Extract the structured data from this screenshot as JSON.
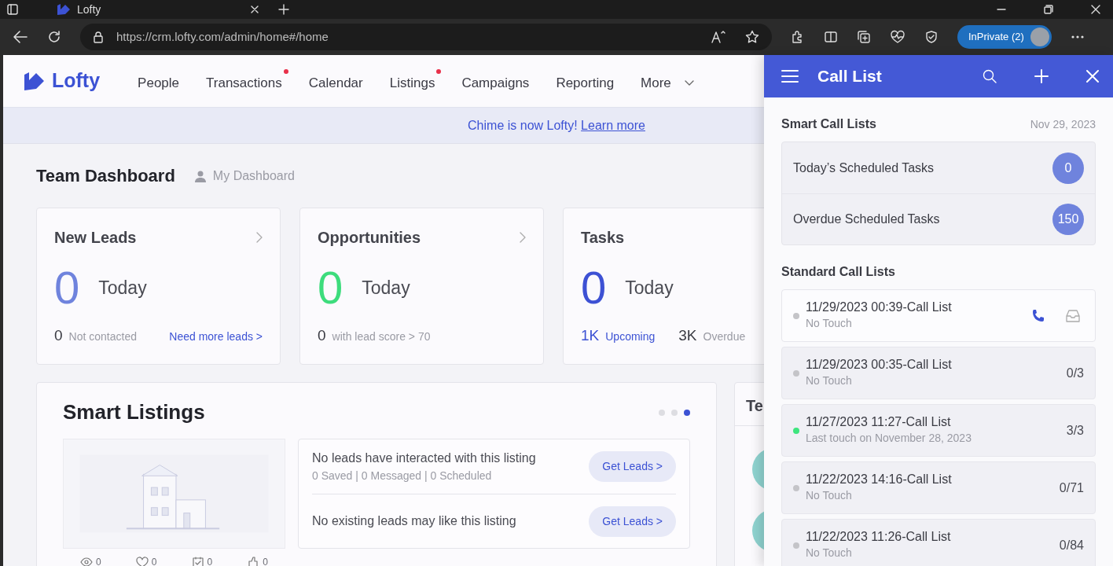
{
  "browser": {
    "tab_title": "Lofty",
    "url": "https://crm.lofty.com/admin/home#/home",
    "profile_label": "InPrivate (2)"
  },
  "nav": {
    "logo": "Lofty",
    "items": [
      {
        "label": "People",
        "dot": false,
        "kind": "link"
      },
      {
        "label": "Transactions",
        "dot": true,
        "kind": "link"
      },
      {
        "label": "Calendar",
        "dot": false,
        "kind": "link"
      },
      {
        "label": "Listings",
        "dot": true,
        "kind": "link"
      },
      {
        "label": "Campaigns",
        "dot": false,
        "kind": "link"
      },
      {
        "label": "Reporting",
        "dot": false,
        "kind": "link"
      },
      {
        "label": "More",
        "dot": false,
        "kind": "dropdown"
      }
    ]
  },
  "banner": {
    "text": "Chime is now Lofty!",
    "link": "Learn more"
  },
  "dashboard": {
    "title": "Team Dashboard",
    "switch_label": "My Dashboard"
  },
  "cards": [
    {
      "title": "New Leads",
      "arrow": true,
      "count": "0",
      "color": "#6f83dd",
      "period": "Today",
      "stats": [
        {
          "value": "0",
          "label": "Not contacted",
          "accent": false
        }
      ],
      "link": "Need more leads >"
    },
    {
      "title": "Opportunities",
      "arrow": true,
      "count": "0",
      "color": "#3ddc7c",
      "period": "Today",
      "stats": [
        {
          "value": "0",
          "label": "with lead score > 70",
          "accent": false
        }
      ]
    },
    {
      "title": "Tasks",
      "arrow": false,
      "count": "0",
      "color": "#3d51d4",
      "period": "Today",
      "stats": [
        {
          "value": "1K",
          "label": "Upcoming",
          "accent": true
        },
        {
          "value": "3K",
          "label": "Overdue",
          "accent": false
        }
      ]
    }
  ],
  "smart_listings": {
    "title": "Smart Listings",
    "pages": [
      {
        "selected": false
      },
      {
        "selected": false
      },
      {
        "selected": true
      }
    ],
    "listing": {
      "kind": "picture",
      "stats": [
        {
          "kind": "views",
          "value": "0"
        },
        {
          "kind": "likes",
          "value": "0"
        },
        {
          "kind": "scheduled",
          "value": "0"
        },
        {
          "kind": "shares",
          "value": "0"
        }
      ]
    },
    "rows": [
      {
        "text": "No leads have interacted with this listing",
        "detail": "0 Saved | 0 Messaged | 0 Scheduled",
        "button": "Get Leads >"
      },
      {
        "text": "No existing leads may like this listing",
        "button": "Get Leads >"
      }
    ]
  },
  "side_card": {
    "title": "Te"
  },
  "call_list": {
    "title": "Call List",
    "smart_title": "Smart Call Lists",
    "date": "Nov 29, 2023",
    "smart_lists": [
      {
        "name": "Today’s Scheduled Tasks",
        "count": "0"
      },
      {
        "name": "Overdue Scheduled Tasks",
        "count": "150"
      }
    ],
    "standard_title": "Standard Call Lists",
    "standard_lists": [
      {
        "name": "11/29/2023 00:39-Call List",
        "status": "No Touch",
        "color": "#c4c4c8",
        "hovered": true
      },
      {
        "name": "11/29/2023 00:35-Call List",
        "status": "No Touch",
        "color": "#c4c4c8",
        "hovered": false,
        "progress": "0/3"
      },
      {
        "name": "11/27/2023 11:27-Call List",
        "status": "Last touch on November 28, 2023",
        "color": "#3ee57e",
        "hovered": false,
        "progress": "3/3"
      },
      {
        "name": "11/22/2023 14:16-Call List",
        "status": "No Touch",
        "color": "#c4c4c8",
        "hovered": false,
        "progress": "0/71"
      },
      {
        "name": "11/22/2023 11:26-Call List",
        "status": "No Touch",
        "color": "#c4c4c8",
        "hovered": false,
        "progress": "0/84"
      }
    ]
  }
}
